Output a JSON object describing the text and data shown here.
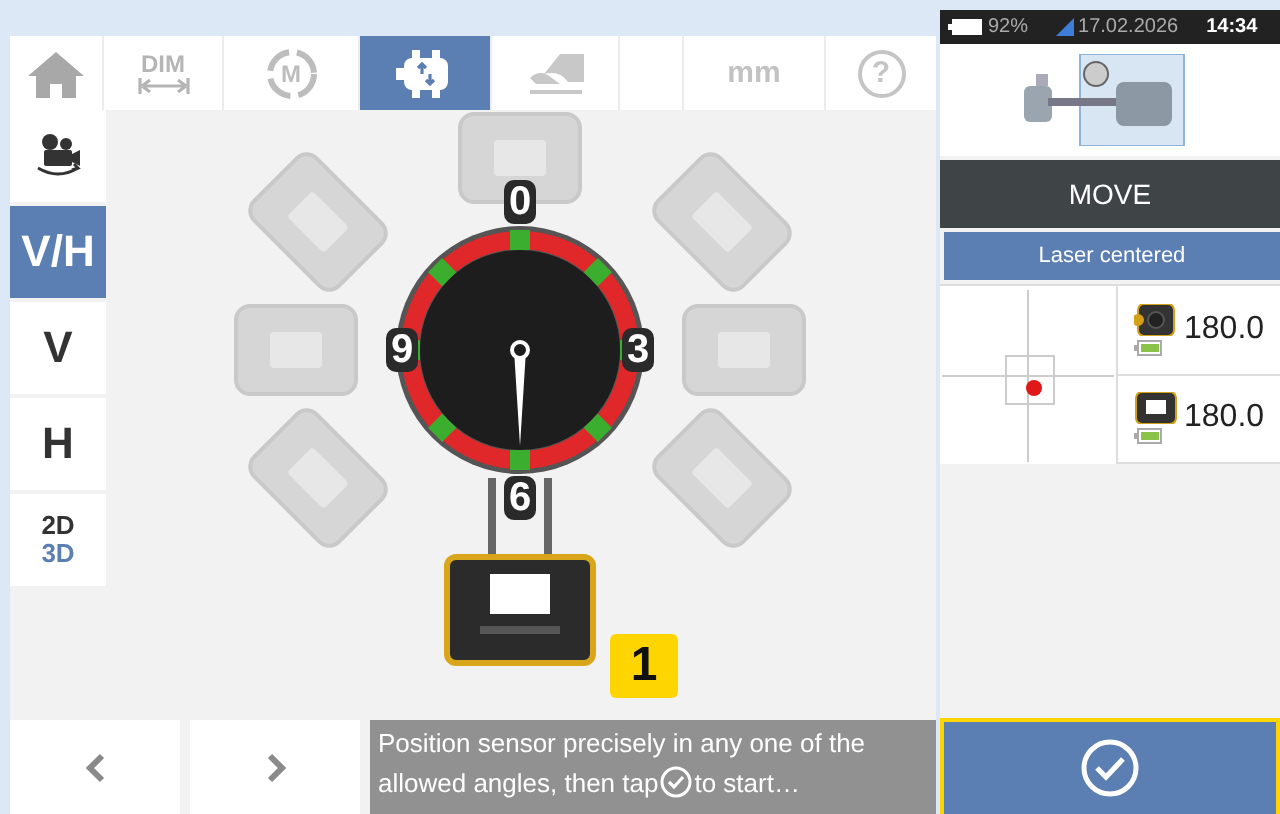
{
  "toolbar": [
    {
      "kind": "home",
      "selected": false
    },
    {
      "kind": "dim",
      "label": "DIM",
      "selected": false
    },
    {
      "kind": "measure",
      "label": "M",
      "selected": false
    },
    {
      "kind": "sensor",
      "selected": true
    },
    {
      "kind": "foot",
      "selected": false
    },
    {
      "kind": "blank",
      "selected": false
    },
    {
      "kind": "unit",
      "label": "mm",
      "selected": false
    },
    {
      "kind": "help",
      "label": "?",
      "selected": false
    }
  ],
  "sidebar": [
    {
      "kind": "camera",
      "selected": false
    },
    {
      "kind": "text",
      "label": "V/H",
      "selected": true
    },
    {
      "kind": "text",
      "label": "V",
      "selected": false
    },
    {
      "kind": "text",
      "label": "H",
      "selected": false
    },
    {
      "kind": "view",
      "label": "2D",
      "label_alt": "3D",
      "selected": false
    }
  ],
  "dial": {
    "labels": [
      "0",
      "3",
      "6",
      "9"
    ]
  },
  "sensor_positions": [
    {
      "selected": false
    },
    {
      "selected": false
    },
    {
      "selected": false
    },
    {
      "selected": false
    },
    {
      "selected": true
    },
    {
      "selected": false
    },
    {
      "selected": false
    },
    {
      "selected": false
    }
  ],
  "position_badge": "1",
  "message": {
    "before": "Position sensor precisely in any one of the allowed angles, then tap",
    "after": "to start…"
  },
  "status_bar": {
    "battery": "92%",
    "date": "17.02.2026",
    "time": "14:34"
  },
  "move_button": "MOVE",
  "laser_status": "Laser centered",
  "readings": [
    {
      "kind": "laser",
      "value": "180.0"
    },
    {
      "kind": "sensor",
      "value": "180.0"
    }
  ]
}
